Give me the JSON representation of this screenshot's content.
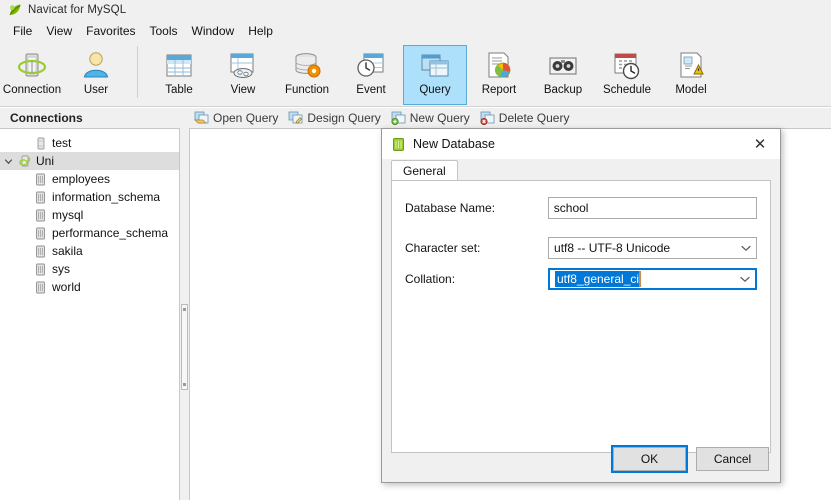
{
  "window": {
    "title": "Navicat for MySQL",
    "app_icon": "navicat-leaf-icon"
  },
  "menubar": {
    "items": [
      {
        "label": "File"
      },
      {
        "label": "View"
      },
      {
        "label": "Favorites"
      },
      {
        "label": "Tools"
      },
      {
        "label": "Window"
      },
      {
        "label": "Help"
      }
    ]
  },
  "toolbar": {
    "groups": [
      {
        "buttons": [
          {
            "label": "Connection",
            "icon": "connection-icon",
            "active": false
          },
          {
            "label": "User",
            "icon": "user-icon",
            "active": false
          }
        ]
      },
      {
        "buttons": [
          {
            "label": "Table",
            "icon": "table-icon",
            "active": false
          },
          {
            "label": "View",
            "icon": "view-icon",
            "active": false
          },
          {
            "label": "Function",
            "icon": "function-icon",
            "active": false
          },
          {
            "label": "Event",
            "icon": "event-icon",
            "active": false
          },
          {
            "label": "Query",
            "icon": "query-icon",
            "active": true
          },
          {
            "label": "Report",
            "icon": "report-icon",
            "active": false
          },
          {
            "label": "Backup",
            "icon": "backup-icon",
            "active": false
          },
          {
            "label": "Schedule",
            "icon": "schedule-icon",
            "active": false
          },
          {
            "label": "Model",
            "icon": "model-icon",
            "active": false
          }
        ]
      }
    ]
  },
  "subbar": {
    "connections_header": "Connections",
    "actions": [
      {
        "label": "Open Query",
        "icon": "open-query-icon"
      },
      {
        "label": "Design Query",
        "icon": "design-query-icon"
      },
      {
        "label": "New Query",
        "icon": "new-query-icon"
      },
      {
        "label": "Delete Query",
        "icon": "delete-query-icon"
      }
    ]
  },
  "sidebar": {
    "tree": [
      {
        "label": "test",
        "icon": "connection-grey-icon",
        "level": 1,
        "expanded": false,
        "selected": false,
        "expander": ""
      },
      {
        "label": "Uni",
        "icon": "connection-green-icon",
        "level": 0,
        "expanded": true,
        "selected": true,
        "expander": "⌄"
      },
      {
        "label": "employees",
        "icon": "database-grey-icon",
        "level": 2,
        "selected": false,
        "expander": ""
      },
      {
        "label": "information_schema",
        "icon": "database-grey-icon",
        "level": 2,
        "selected": false,
        "expander": ""
      },
      {
        "label": "mysql",
        "icon": "database-grey-icon",
        "level": 2,
        "selected": false,
        "expander": ""
      },
      {
        "label": "performance_schema",
        "icon": "database-grey-icon",
        "level": 2,
        "selected": false,
        "expander": ""
      },
      {
        "label": "sakila",
        "icon": "database-grey-icon",
        "level": 2,
        "selected": false,
        "expander": ""
      },
      {
        "label": "sys",
        "icon": "database-grey-icon",
        "level": 2,
        "selected": false,
        "expander": ""
      },
      {
        "label": "world",
        "icon": "database-grey-icon",
        "level": 2,
        "selected": false,
        "expander": ""
      }
    ]
  },
  "dialog": {
    "title": "New Database",
    "title_icon": "database-green-icon",
    "close_label": "✕",
    "tabs": [
      {
        "label": "General",
        "active": true
      }
    ],
    "fields": {
      "database_name": {
        "label": "Database Name:",
        "value": "school",
        "placeholder": ""
      },
      "character_set": {
        "label": "Character set:",
        "value": "utf8 -- UTF-8 Unicode"
      },
      "collation": {
        "label": "Collation:",
        "value": "utf8_general_ci",
        "focused": true,
        "text_selected": true
      }
    },
    "buttons": {
      "ok": "OK",
      "cancel": "Cancel"
    }
  },
  "colors": {
    "accent_blue": "#0078d7",
    "toolbar_active": "#ade0fa",
    "window_bg": "#f0f0f0",
    "selection_grey": "#dddddd",
    "navicat_green": "#8dc63f"
  }
}
